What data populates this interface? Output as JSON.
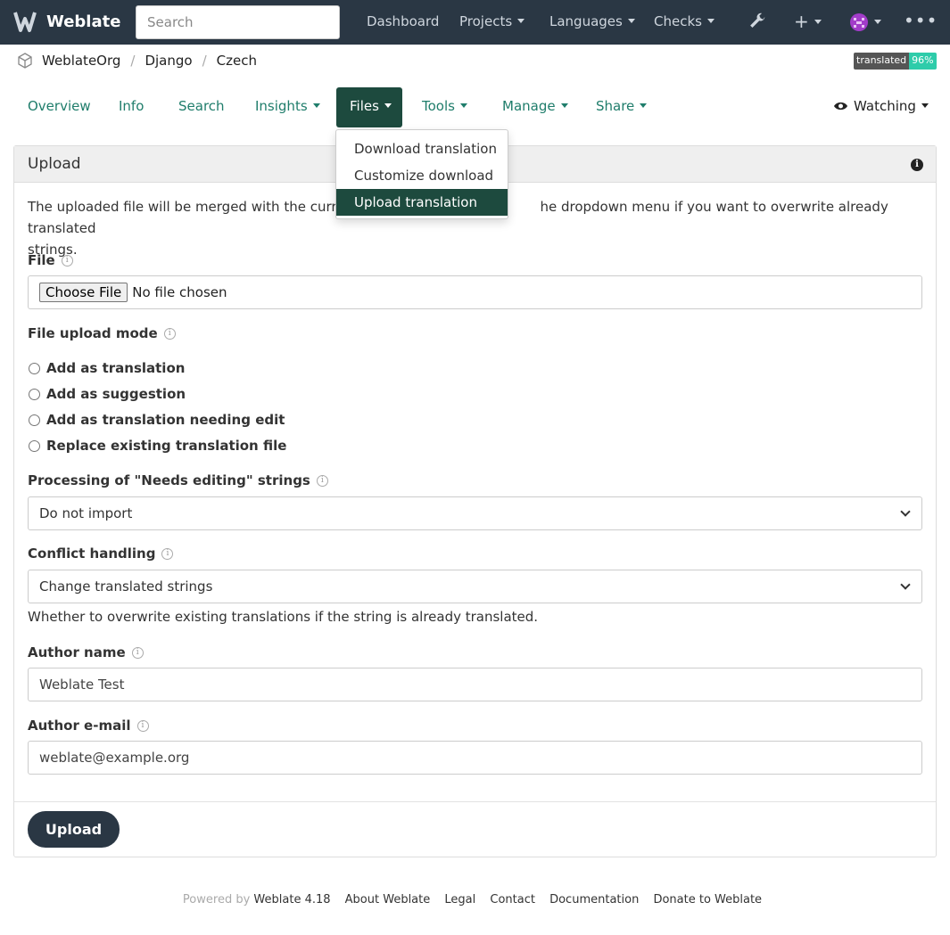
{
  "navbar": {
    "brand": "Weblate",
    "search_placeholder": "Search",
    "items": [
      "Dashboard",
      "Projects",
      "Languages",
      "Checks"
    ]
  },
  "breadcrumb": [
    "WeblateOrg",
    "Django",
    "Czech"
  ],
  "badge": {
    "label": "translated",
    "value": "96%"
  },
  "tabs": [
    "Overview",
    "Info",
    "Search",
    "Insights",
    "Files",
    "Tools",
    "Manage",
    "Share"
  ],
  "watching": "Watching",
  "files_menu": [
    "Download translation",
    "Customize download",
    "Upload translation"
  ],
  "panel": {
    "title": "Upload",
    "description_left": "The uploaded file will be merged with the current t",
    "description_right": "he dropdown menu if you want to overwrite already translated",
    "description_line2": "strings.",
    "file_label": "File",
    "file_button": "Choose File",
    "file_status": "No file chosen",
    "mode_label": "File upload mode",
    "modes": [
      "Add as translation",
      "Add as suggestion",
      "Add as translation needing edit",
      "Replace existing translation file"
    ],
    "needs_editing_label": "Processing of \"Needs editing\" strings",
    "needs_editing_value": "Do not import",
    "conflict_label": "Conflict handling",
    "conflict_value": "Change translated strings",
    "conflict_hint": "Whether to overwrite existing translations if the string is already translated.",
    "author_name_label": "Author name",
    "author_name_value": "Weblate Test",
    "author_email_label": "Author e-mail",
    "author_email_value": "weblate@example.org",
    "submit": "Upload"
  },
  "footer": {
    "powered": "Powered by",
    "links": [
      "Weblate 4.18",
      "About Weblate",
      "Legal",
      "Contact",
      "Documentation",
      "Donate to Weblate"
    ]
  },
  "colors": {
    "navbar": "#2a3744",
    "accent": "#1f7d6b",
    "active": "#1d4a3e",
    "badge": "#2eccaa"
  }
}
